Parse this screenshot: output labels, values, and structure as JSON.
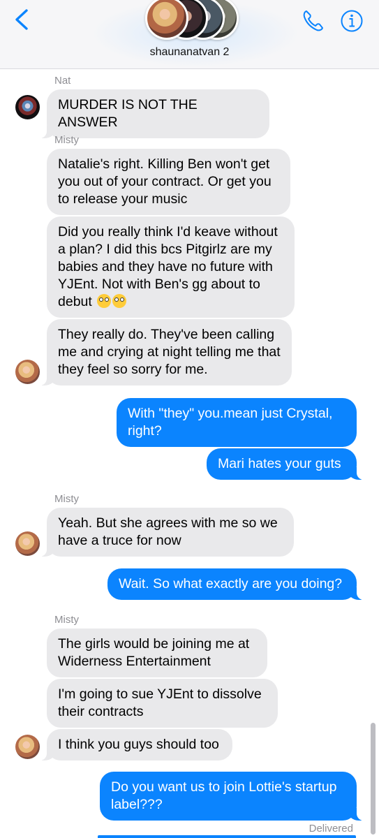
{
  "header": {
    "group_name": "shaunanatvan 2",
    "back_icon": "chevron-left-icon",
    "call_icon": "phone-icon",
    "info_icon": "info-icon",
    "accent_color": "#0b84fe"
  },
  "messages": [
    {
      "sender_label": "Nat",
      "direction": "incoming",
      "text": "MURDER IS NOT THE ANSWER"
    },
    {
      "sender_label": "Misty",
      "direction": "incoming",
      "text": "Natalie's right. Killing Ben won't get you out of your contract. Or get you to release your music"
    },
    {
      "direction": "incoming",
      "text": "Did you really think I'd keave without a plan? I did this bcs Pitgirlz are my babies and they have no future with YJEnt. Not with Ben's gg about to debut",
      "emoji": "face-with-rolling-eyes x2"
    },
    {
      "direction": "incoming",
      "text": "They really do. They've been calling me and crying at night telling me that they feel so sorry for me."
    },
    {
      "direction": "outgoing",
      "text": "With \"they\" you.mean just Crystal, right?"
    },
    {
      "direction": "outgoing",
      "text": "Mari hates your guts"
    },
    {
      "sender_label": "Misty",
      "direction": "incoming",
      "text": "Yeah. But she agrees with me so we have a truce for now"
    },
    {
      "direction": "outgoing",
      "text": "Wait. So what exactly are you doing?"
    },
    {
      "sender_label": "Misty",
      "direction": "incoming",
      "text": "The girls would be joining me at Widerness Entertainment"
    },
    {
      "direction": "incoming",
      "text": "I'm going to sue YJEnt to dissolve their contracts"
    },
    {
      "direction": "incoming",
      "text": "I think you guys should too"
    },
    {
      "direction": "outgoing",
      "text": "Do you want us to join Lottie's startup label???"
    }
  ],
  "status": {
    "delivered": "Delivered"
  }
}
